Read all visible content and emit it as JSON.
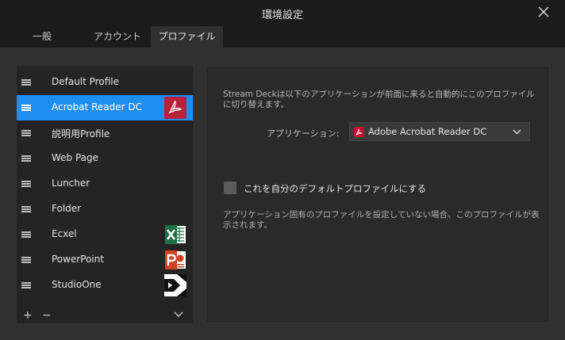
{
  "window": {
    "title": "環境設定",
    "close_icon": "close-icon"
  },
  "tabs": [
    {
      "label": "一般",
      "active": false
    },
    {
      "label": "アカウント",
      "active": false
    },
    {
      "label": "プロファイル",
      "active": true
    }
  ],
  "profiles": [
    {
      "label": "Default Profile",
      "icon": null,
      "selected": false
    },
    {
      "label": "Acrobat Reader DC",
      "icon": "acrobat-icon",
      "selected": true
    },
    {
      "label": "説明用Profile",
      "icon": null,
      "selected": false
    },
    {
      "label": "Web Page",
      "icon": null,
      "selected": false
    },
    {
      "label": "Luncher",
      "icon": null,
      "selected": false
    },
    {
      "label": "Folder",
      "icon": null,
      "selected": false
    },
    {
      "label": "Ecxel",
      "icon": "excel-icon",
      "selected": false
    },
    {
      "label": "PowerPoint",
      "icon": "powerpoint-icon",
      "selected": false
    },
    {
      "label": "StudioOne",
      "icon": "studio-one-icon",
      "selected": false
    }
  ],
  "profile_footer": {
    "add": "+",
    "remove": "−"
  },
  "settings": {
    "description": "Stream Deckは以下のアプリケーションが前面に来ると自動的にこのプロファイルに切り替えます。",
    "application_label": "アプリケーション:",
    "application_value": "Adobe Acrobat Reader DC",
    "default_checkbox_label": "これを自分のデフォルトプロファイルにする",
    "default_checked": false,
    "note": "アプリケーション固有のプロファイルを設定していない場合、このプロファイルが表示されます。"
  },
  "colors": {
    "selection": "#1f8ef1",
    "acrobat": "#c8102e",
    "excel": "#1d7044",
    "powerpoint": "#d04423"
  }
}
